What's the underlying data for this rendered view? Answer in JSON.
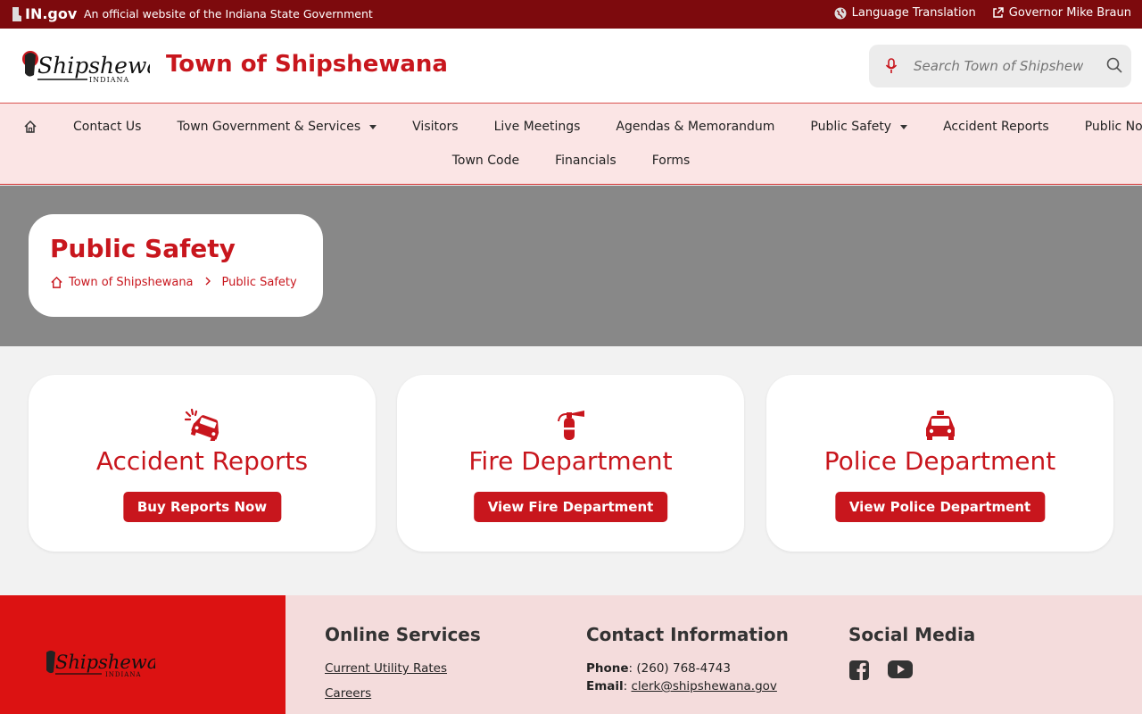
{
  "topbar": {
    "ingov": "IN.gov",
    "official": "An official website of the Indiana State Government",
    "language": "Language Translation",
    "governor": "Governor Mike Braun"
  },
  "header": {
    "logo_text": "Shipshewana",
    "logo_sub": "INDIANA",
    "site_title": "Town of Shipshewana",
    "search_placeholder": "Search Town of Shipshewana"
  },
  "nav": {
    "row1": [
      {
        "label": "Contact Us"
      },
      {
        "label": "Town Government & Services",
        "dropdown": true
      },
      {
        "label": "Visitors"
      },
      {
        "label": "Live Meetings"
      },
      {
        "label": "Agendas & Memorandum"
      },
      {
        "label": "Public Safety",
        "dropdown": true
      },
      {
        "label": "Accident Reports"
      },
      {
        "label": "Public Notices"
      }
    ],
    "row2": [
      {
        "label": "Town Code"
      },
      {
        "label": "Financials"
      },
      {
        "label": "Forms"
      }
    ]
  },
  "page": {
    "title": "Public Safety",
    "breadcrumb": [
      "Town of Shipshewana",
      "Public Safety"
    ]
  },
  "cards": [
    {
      "title": "Accident Reports",
      "button": "Buy Reports Now",
      "icon": "car-crash-icon"
    },
    {
      "title": "Fire Department",
      "button": "View Fire Department",
      "icon": "fire-extinguisher-icon"
    },
    {
      "title": "Police Department",
      "button": "View Police Department",
      "icon": "police-car-icon"
    }
  ],
  "footer": {
    "online_services": {
      "heading": "Online Services",
      "links": [
        "Current Utility Rates",
        "Careers"
      ]
    },
    "contact": {
      "heading": "Contact Information",
      "phone_label": "Phone",
      "phone": "(260) 768-4743",
      "email_label": "Email",
      "email": "clerk@shipshewana.gov"
    },
    "social": {
      "heading": "Social Media",
      "icons": [
        "facebook-icon",
        "youtube-icon"
      ]
    }
  },
  "colors": {
    "brand_red": "#c8161d",
    "topbar": "#7d0a0d",
    "nav_bg": "#fbe5e5",
    "banner": "#888888",
    "footer_left": "#dc1212"
  }
}
